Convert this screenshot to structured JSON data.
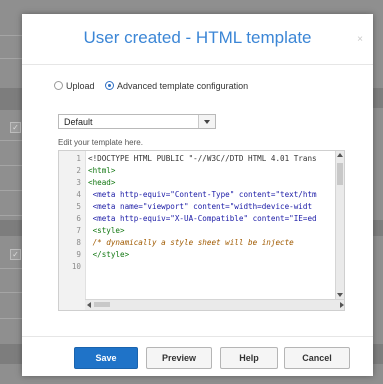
{
  "modal": {
    "title": "User created - HTML template",
    "close_glyph": "×"
  },
  "mode": {
    "options": [
      {
        "label": "Upload",
        "selected": false
      },
      {
        "label": "Advanced template configuration",
        "selected": true
      }
    ]
  },
  "template_select": {
    "value": "Default"
  },
  "editor": {
    "hint": "Edit your template here.",
    "lines": [
      {
        "n": "1",
        "text": "<!DOCTYPE HTML PUBLIC \"-//W3C//DTD HTML 4.01 Trans"
      },
      {
        "n": "2",
        "text": "<html>"
      },
      {
        "n": "3",
        "text": "<head>"
      },
      {
        "n": "4",
        "text": "  <meta http-equiv=\"Content-Type\" content=\"text/htm"
      },
      {
        "n": "5",
        "text": "  <meta name=\"viewport\" content=\"width=device-widt"
      },
      {
        "n": "6",
        "text": "  <meta http-equiv=\"X-UA-Compatible\" content=\"IE=ed"
      },
      {
        "n": "7",
        "text": "  <style>"
      },
      {
        "n": "8",
        "text": "    /* dynamically a style sheet will be injecte"
      },
      {
        "n": "9",
        "text": "  </style>"
      },
      {
        "n": "10",
        "text": ""
      }
    ]
  },
  "buttons": {
    "save": "Save",
    "preview": "Preview",
    "help": "Help",
    "cancel": "Cancel"
  },
  "colors": {
    "title": "#3b86d6",
    "primary_button": "#1f73c8",
    "overlay": "#8f8f8f"
  },
  "icons": {
    "close": "close-icon",
    "dropdown": "chevron-down-icon"
  }
}
